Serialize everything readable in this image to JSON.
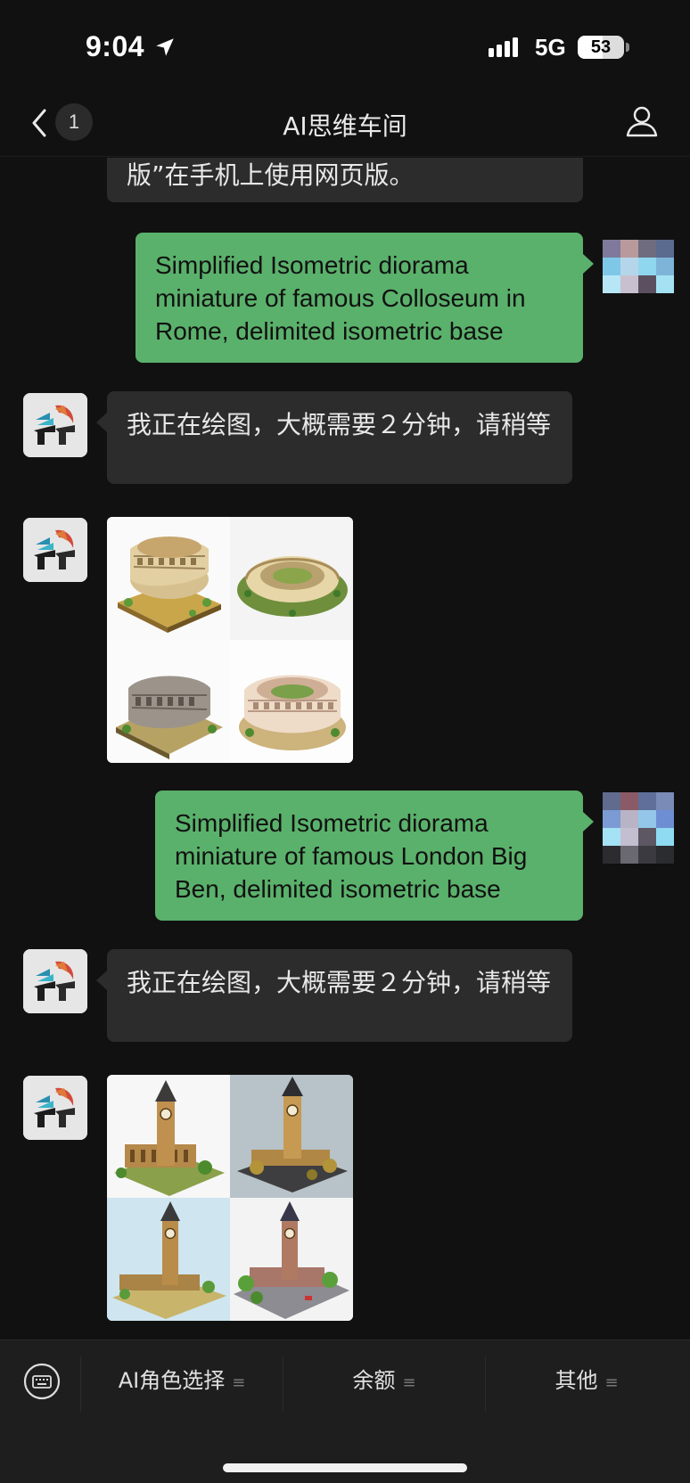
{
  "status_bar": {
    "time": "9:04",
    "network": "5G",
    "battery": "53",
    "battery_level": 0.53
  },
  "nav": {
    "back_count": "1",
    "title": "AI思维车间"
  },
  "messages": [
    {
      "side": "left",
      "type": "text",
      "text": "版”在手机上使用网页版。"
    },
    {
      "side": "right",
      "type": "text",
      "text": "Simplified Isometric diorama miniature of famous Colloseum in Rome, delimited isometric base"
    },
    {
      "side": "left",
      "type": "text",
      "text": "我正在绘图，大概需要２分钟，请稍等"
    },
    {
      "side": "left",
      "type": "image",
      "subject": "colosseum"
    },
    {
      "side": "right",
      "type": "text",
      "text": "Simplified Isometric diorama miniature of famous London Big Ben, delimited isometric base"
    },
    {
      "side": "left",
      "type": "text",
      "text": "我正在绘图，大概需要２分钟，请稍等"
    },
    {
      "side": "left",
      "type": "image",
      "subject": "big-ben"
    }
  ],
  "menu": {
    "items": [
      {
        "label": "AI角色选择"
      },
      {
        "label": "余额"
      },
      {
        "label": "其他"
      }
    ]
  },
  "colors": {
    "background": "#111111",
    "bubble_self": "#5ab16b",
    "bubble_other": "#2c2c2c"
  }
}
